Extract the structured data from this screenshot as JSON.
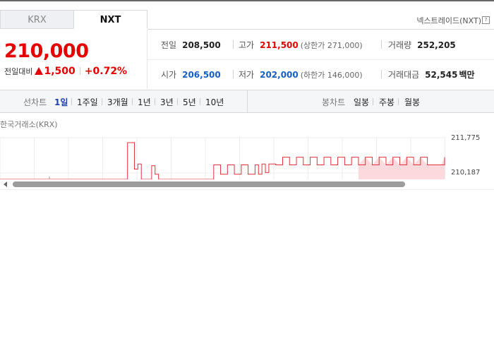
{
  "market_tabs": [
    {
      "label": "KRX"
    },
    {
      "label": "NXT"
    }
  ],
  "active_market": "NXT",
  "market_info_label": "넥스트레이드(NXT)",
  "help_icon": "?",
  "price": {
    "current": "210,000",
    "change_label": "전일대비",
    "change_icon": "up-triangle-icon",
    "change_amount": "1,500",
    "change_percent": "+0.72%"
  },
  "stats": {
    "prev_close": {
      "label": "전일",
      "value": "208,500"
    },
    "high": {
      "label": "고가",
      "value": "211,500",
      "sub": "(상한가 271,000)"
    },
    "volume": {
      "label": "거래량",
      "value": "252,205"
    },
    "open": {
      "label": "시가",
      "value": "206,500"
    },
    "low": {
      "label": "저가",
      "value": "202,000",
      "sub": "(하한가 146,000)"
    },
    "turnover": {
      "label": "거래대금",
      "value": "52,545",
      "unit": "백만"
    }
  },
  "toolbar": {
    "line_label": "선차트",
    "line_periods": [
      "1일",
      "1주일",
      "3개월",
      "1년",
      "3년",
      "5년",
      "10년"
    ],
    "active_period": "1일",
    "candle_label": "봉차트",
    "candle_periods": [
      "일봉",
      "주봉",
      "월봉"
    ]
  },
  "chart_data": {
    "type": "line",
    "title": "한국거래소(KRX)",
    "y_ticks": [
      "211,775",
      "210,187"
    ],
    "ylim": [
      209600,
      212000
    ],
    "series": [
      {
        "color": "#e8303a",
        "x": [
          0,
          36,
          37,
          38,
          39,
          40,
          41,
          42,
          44,
          45,
          46,
          47,
          48,
          50,
          52,
          54,
          56,
          58,
          60,
          61,
          62,
          64,
          66,
          68,
          70,
          72,
          74,
          75,
          76,
          77,
          78,
          80,
          82,
          84,
          86,
          88,
          90,
          92,
          94,
          96,
          98,
          100,
          102,
          104,
          106,
          108,
          110,
          112,
          114,
          116,
          118,
          120,
          122,
          124,
          126,
          127,
          128,
          129
        ],
        "y": [
          209600,
          209600,
          211750,
          211750,
          210200,
          210500,
          209600,
          209600,
          210400,
          209900,
          209600,
          209600,
          209600,
          209600,
          209600,
          209600,
          209600,
          209600,
          209600,
          209600,
          210450,
          209900,
          210450,
          209900,
          210450,
          209900,
          210450,
          209900,
          210500,
          210000,
          210500,
          210450,
          210900,
          210450,
          210900,
          210450,
          210900,
          210450,
          210900,
          210450,
          210900,
          210450,
          210900,
          210450,
          210900,
          210450,
          210900,
          210450,
          210900,
          210450,
          210900,
          210450,
          210900,
          210450,
          210450,
          210450,
          210450,
          210900
        ]
      }
    ]
  },
  "scrollbar": {
    "left_arrow_icon": "chevron-left-icon"
  }
}
